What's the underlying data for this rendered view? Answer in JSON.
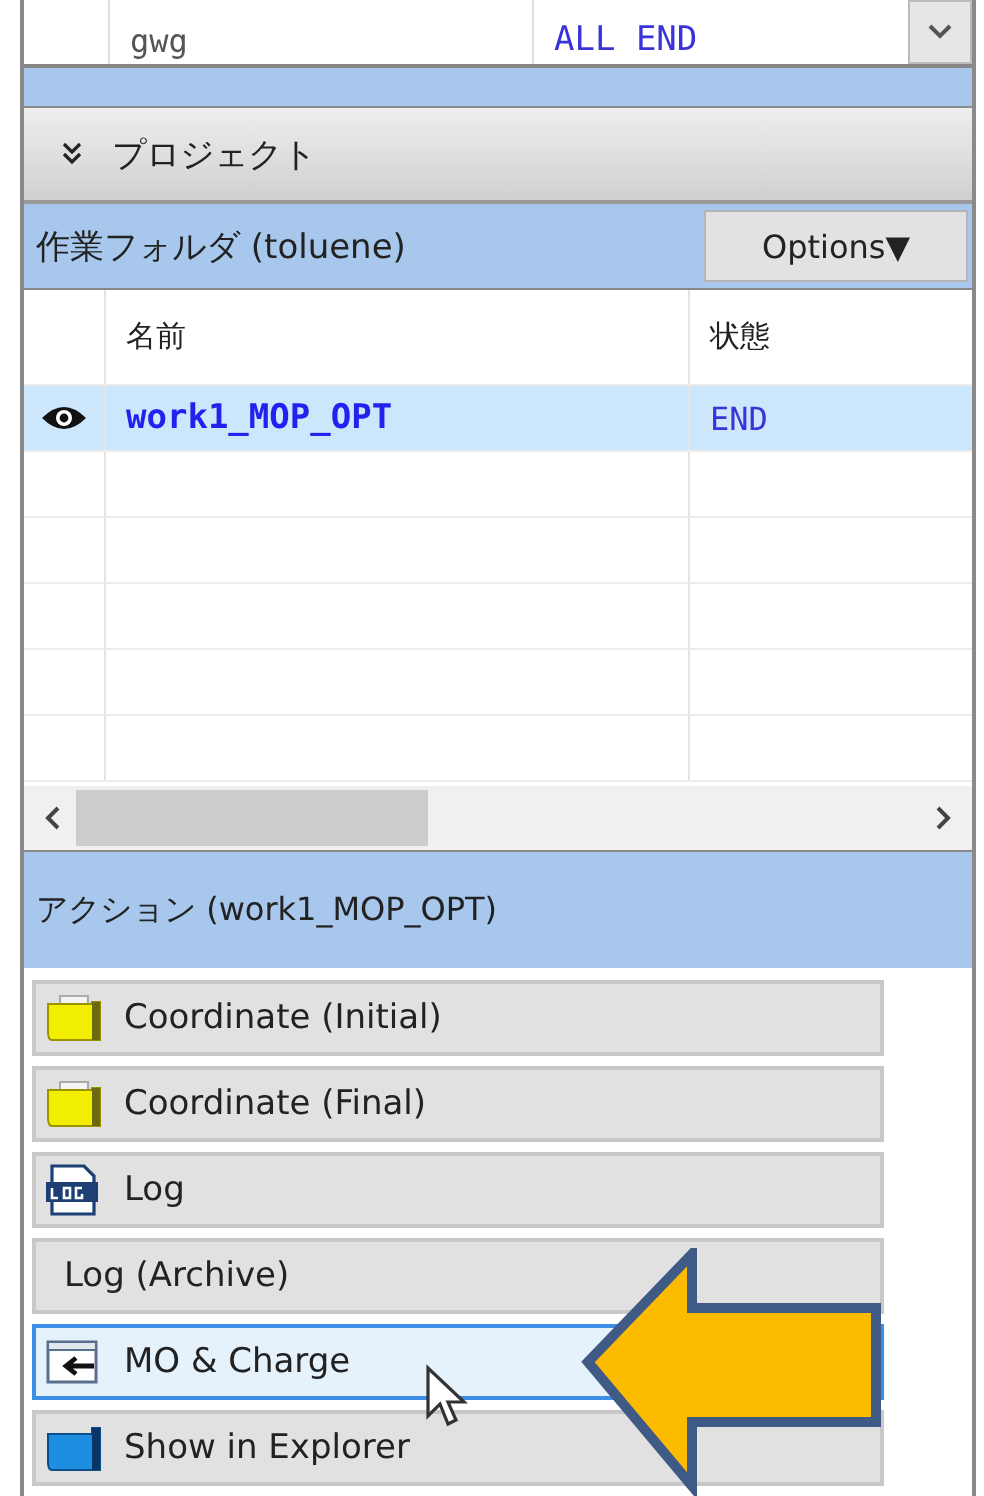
{
  "top_table": {
    "row": {
      "name": "gwg",
      "status": "ALL END"
    }
  },
  "project_section": {
    "title": "プロジェクト",
    "expanded": true
  },
  "work_folder": {
    "title": "作業フォルダ (toluene)",
    "options_button": "Options▼",
    "columns": [
      "名前",
      "状態"
    ],
    "rows": [
      {
        "name": "work1_MOP_OPT",
        "status": "END",
        "selected": true,
        "visible": true
      }
    ]
  },
  "actions": {
    "title": "アクション (work1_MOP_OPT)",
    "items": [
      {
        "label": "Coordinate (Initial)",
        "kind": "coordinate",
        "selected": false
      },
      {
        "label": "Coordinate (Final)",
        "kind": "coordinate",
        "selected": false
      },
      {
        "label": "Log",
        "kind": "log",
        "selected": false
      },
      {
        "label": "Log (Archive)",
        "kind": "plain",
        "selected": false
      },
      {
        "label": "MO & Charge",
        "kind": "import",
        "selected": true
      },
      {
        "label": "Show in Explorer",
        "kind": "explorer",
        "selected": false
      }
    ]
  }
}
